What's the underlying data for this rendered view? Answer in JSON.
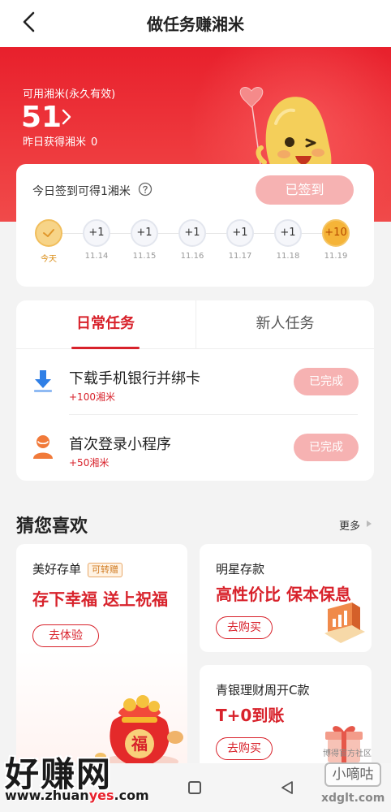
{
  "header": {
    "title": "做任务赚湘米",
    "back_icon": "chevron-left-icon"
  },
  "balance": {
    "label": "可用湘米(永久有效)",
    "amount": "51",
    "yesterday_label": "昨日获得湘米",
    "yesterday_value": "0"
  },
  "signin": {
    "text": "今日签到可得1湘米",
    "button": "已签到",
    "days": [
      {
        "value": "",
        "label": "今天",
        "state": "today"
      },
      {
        "value": "+1",
        "label": "11.14",
        "state": "normal"
      },
      {
        "value": "+1",
        "label": "11.15",
        "state": "normal"
      },
      {
        "value": "+1",
        "label": "11.16",
        "state": "normal"
      },
      {
        "value": "+1",
        "label": "11.17",
        "state": "normal"
      },
      {
        "value": "+1",
        "label": "11.18",
        "state": "normal"
      },
      {
        "value": "+10",
        "label": "11.19",
        "state": "big"
      }
    ]
  },
  "tasks": {
    "tabs": [
      "日常任务",
      "新人任务"
    ],
    "items": [
      {
        "name": "下载手机银行并绑卡",
        "reward": "+100湘米",
        "status": "已完成",
        "icon": "download-icon"
      },
      {
        "name": "首次登录小程序",
        "reward": "+50湘米",
        "status": "已完成",
        "icon": "user-icon"
      }
    ]
  },
  "recommend": {
    "title": "猜您喜欢",
    "more": "更多",
    "products": [
      {
        "name": "美好存单",
        "tag": "可转赠",
        "slogan": "存下幸福 送上祝福",
        "button": "去体验"
      },
      {
        "name": "明星存款",
        "slogan": "高性价比 保本保息",
        "button": "去购买"
      },
      {
        "name": "青银理财周开C款",
        "slogan": "T+0到账",
        "button": "去购买"
      }
    ],
    "bag_text": "福"
  },
  "watermarks": {
    "left_big": "好赚网",
    "left_url_a": "www.zhuan",
    "left_url_b": "yes",
    "left_url_c": ".com",
    "right_top": "博得官方社区",
    "right_box": "小嘀咕",
    "right_url": "xdglt.com"
  },
  "colors": {
    "brand_red": "#d8222b",
    "soft_red": "#f6b2b2",
    "gold": "#f5b438"
  }
}
